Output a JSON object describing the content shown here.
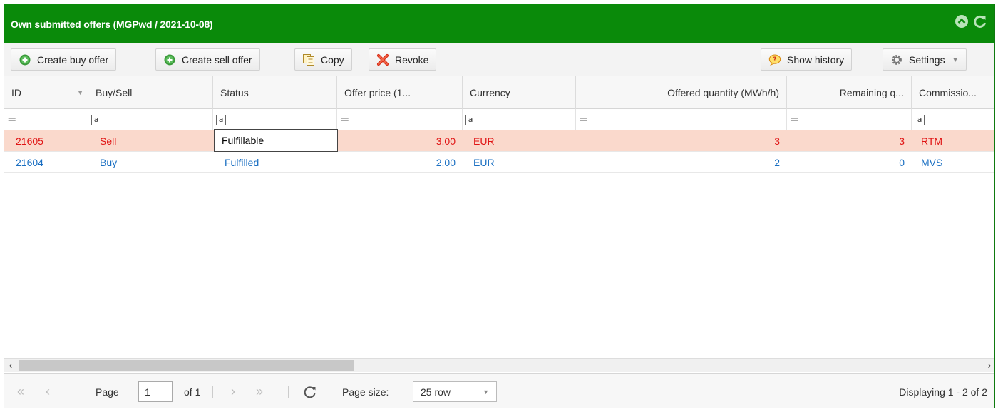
{
  "window": {
    "title": "Own submitted offers (MGPwd / 2021-10-08)"
  },
  "toolbar": {
    "create_buy": "Create buy offer",
    "create_sell": "Create sell offer",
    "copy": "Copy",
    "revoke": "Revoke",
    "show_history": "Show history",
    "settings": "Settings"
  },
  "columns": [
    "ID",
    "Buy/Sell",
    "Status",
    "Offer price (1...",
    "Currency",
    "Offered quantity (MWh/h)",
    "Remaining q...",
    "Commissio..."
  ],
  "filters": {
    "eq": "=",
    "text": "a"
  },
  "rows": [
    {
      "id": "21605",
      "side": "Sell",
      "status": "Fulfillable",
      "price": "3.00",
      "currency": "EUR",
      "offered": "3",
      "remaining": "3",
      "commission": "RTM"
    },
    {
      "id": "21604",
      "side": "Buy",
      "status": "Fulfilled",
      "price": "2.00",
      "currency": "EUR",
      "offered": "2",
      "remaining": "0",
      "commission": "MVS"
    }
  ],
  "pager": {
    "page_label": "Page",
    "page_value": "1",
    "of_label": "of 1",
    "page_size_label": "Page size:",
    "page_size_value": "25 row",
    "displaying": "Displaying 1 - 2 of 2"
  },
  "colors": {
    "title_bg": "#0a8a0a",
    "sell_text": "#e01414",
    "buy_text": "#1a6fc2",
    "selected_row": "#fad9cc"
  }
}
